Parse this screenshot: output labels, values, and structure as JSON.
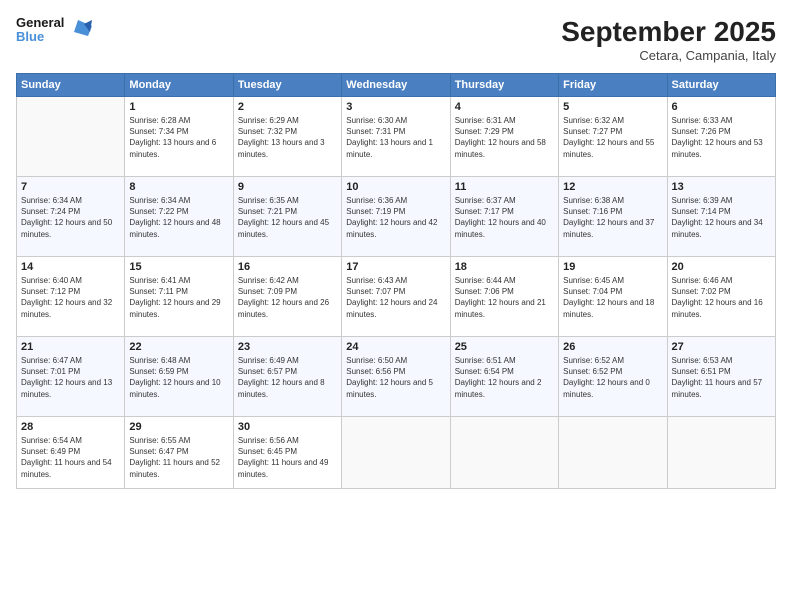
{
  "logo": {
    "general": "General",
    "blue": "Blue"
  },
  "title": "September 2025",
  "subtitle": "Cetara, Campania, Italy",
  "headers": [
    "Sunday",
    "Monday",
    "Tuesday",
    "Wednesday",
    "Thursday",
    "Friday",
    "Saturday"
  ],
  "weeks": [
    [
      {
        "day": "",
        "empty": true
      },
      {
        "day": "1",
        "sunrise": "Sunrise: 6:28 AM",
        "sunset": "Sunset: 7:34 PM",
        "daylight": "Daylight: 13 hours and 6 minutes."
      },
      {
        "day": "2",
        "sunrise": "Sunrise: 6:29 AM",
        "sunset": "Sunset: 7:32 PM",
        "daylight": "Daylight: 13 hours and 3 minutes."
      },
      {
        "day": "3",
        "sunrise": "Sunrise: 6:30 AM",
        "sunset": "Sunset: 7:31 PM",
        "daylight": "Daylight: 13 hours and 1 minute."
      },
      {
        "day": "4",
        "sunrise": "Sunrise: 6:31 AM",
        "sunset": "Sunset: 7:29 PM",
        "daylight": "Daylight: 12 hours and 58 minutes."
      },
      {
        "day": "5",
        "sunrise": "Sunrise: 6:32 AM",
        "sunset": "Sunset: 7:27 PM",
        "daylight": "Daylight: 12 hours and 55 minutes."
      },
      {
        "day": "6",
        "sunrise": "Sunrise: 6:33 AM",
        "sunset": "Sunset: 7:26 PM",
        "daylight": "Daylight: 12 hours and 53 minutes."
      }
    ],
    [
      {
        "day": "7",
        "sunrise": "Sunrise: 6:34 AM",
        "sunset": "Sunset: 7:24 PM",
        "daylight": "Daylight: 12 hours and 50 minutes."
      },
      {
        "day": "8",
        "sunrise": "Sunrise: 6:34 AM",
        "sunset": "Sunset: 7:22 PM",
        "daylight": "Daylight: 12 hours and 48 minutes."
      },
      {
        "day": "9",
        "sunrise": "Sunrise: 6:35 AM",
        "sunset": "Sunset: 7:21 PM",
        "daylight": "Daylight: 12 hours and 45 minutes."
      },
      {
        "day": "10",
        "sunrise": "Sunrise: 6:36 AM",
        "sunset": "Sunset: 7:19 PM",
        "daylight": "Daylight: 12 hours and 42 minutes."
      },
      {
        "day": "11",
        "sunrise": "Sunrise: 6:37 AM",
        "sunset": "Sunset: 7:17 PM",
        "daylight": "Daylight: 12 hours and 40 minutes."
      },
      {
        "day": "12",
        "sunrise": "Sunrise: 6:38 AM",
        "sunset": "Sunset: 7:16 PM",
        "daylight": "Daylight: 12 hours and 37 minutes."
      },
      {
        "day": "13",
        "sunrise": "Sunrise: 6:39 AM",
        "sunset": "Sunset: 7:14 PM",
        "daylight": "Daylight: 12 hours and 34 minutes."
      }
    ],
    [
      {
        "day": "14",
        "sunrise": "Sunrise: 6:40 AM",
        "sunset": "Sunset: 7:12 PM",
        "daylight": "Daylight: 12 hours and 32 minutes."
      },
      {
        "day": "15",
        "sunrise": "Sunrise: 6:41 AM",
        "sunset": "Sunset: 7:11 PM",
        "daylight": "Daylight: 12 hours and 29 minutes."
      },
      {
        "day": "16",
        "sunrise": "Sunrise: 6:42 AM",
        "sunset": "Sunset: 7:09 PM",
        "daylight": "Daylight: 12 hours and 26 minutes."
      },
      {
        "day": "17",
        "sunrise": "Sunrise: 6:43 AM",
        "sunset": "Sunset: 7:07 PM",
        "daylight": "Daylight: 12 hours and 24 minutes."
      },
      {
        "day": "18",
        "sunrise": "Sunrise: 6:44 AM",
        "sunset": "Sunset: 7:06 PM",
        "daylight": "Daylight: 12 hours and 21 minutes."
      },
      {
        "day": "19",
        "sunrise": "Sunrise: 6:45 AM",
        "sunset": "Sunset: 7:04 PM",
        "daylight": "Daylight: 12 hours and 18 minutes."
      },
      {
        "day": "20",
        "sunrise": "Sunrise: 6:46 AM",
        "sunset": "Sunset: 7:02 PM",
        "daylight": "Daylight: 12 hours and 16 minutes."
      }
    ],
    [
      {
        "day": "21",
        "sunrise": "Sunrise: 6:47 AM",
        "sunset": "Sunset: 7:01 PM",
        "daylight": "Daylight: 12 hours and 13 minutes."
      },
      {
        "day": "22",
        "sunrise": "Sunrise: 6:48 AM",
        "sunset": "Sunset: 6:59 PM",
        "daylight": "Daylight: 12 hours and 10 minutes."
      },
      {
        "day": "23",
        "sunrise": "Sunrise: 6:49 AM",
        "sunset": "Sunset: 6:57 PM",
        "daylight": "Daylight: 12 hours and 8 minutes."
      },
      {
        "day": "24",
        "sunrise": "Sunrise: 6:50 AM",
        "sunset": "Sunset: 6:56 PM",
        "daylight": "Daylight: 12 hours and 5 minutes."
      },
      {
        "day": "25",
        "sunrise": "Sunrise: 6:51 AM",
        "sunset": "Sunset: 6:54 PM",
        "daylight": "Daylight: 12 hours and 2 minutes."
      },
      {
        "day": "26",
        "sunrise": "Sunrise: 6:52 AM",
        "sunset": "Sunset: 6:52 PM",
        "daylight": "Daylight: 12 hours and 0 minutes."
      },
      {
        "day": "27",
        "sunrise": "Sunrise: 6:53 AM",
        "sunset": "Sunset: 6:51 PM",
        "daylight": "Daylight: 11 hours and 57 minutes."
      }
    ],
    [
      {
        "day": "28",
        "sunrise": "Sunrise: 6:54 AM",
        "sunset": "Sunset: 6:49 PM",
        "daylight": "Daylight: 11 hours and 54 minutes."
      },
      {
        "day": "29",
        "sunrise": "Sunrise: 6:55 AM",
        "sunset": "Sunset: 6:47 PM",
        "daylight": "Daylight: 11 hours and 52 minutes."
      },
      {
        "day": "30",
        "sunrise": "Sunrise: 6:56 AM",
        "sunset": "Sunset: 6:45 PM",
        "daylight": "Daylight: 11 hours and 49 minutes."
      },
      {
        "day": "",
        "empty": true
      },
      {
        "day": "",
        "empty": true
      },
      {
        "day": "",
        "empty": true
      },
      {
        "day": "",
        "empty": true
      }
    ]
  ]
}
